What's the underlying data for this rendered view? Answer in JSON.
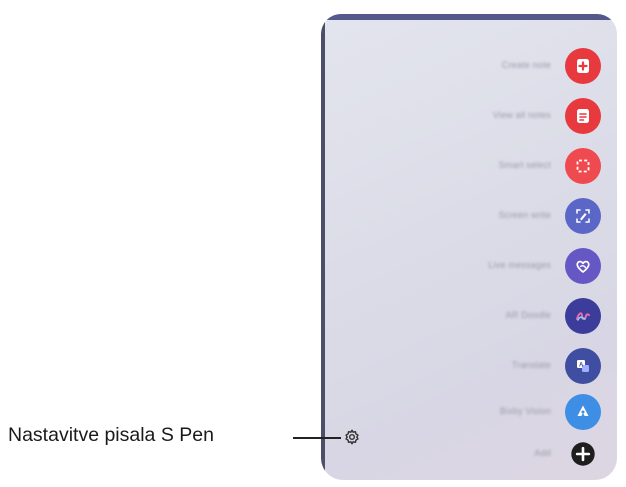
{
  "callout": {
    "label": "Nastavitve pisala S Pen"
  },
  "air_command": {
    "items": [
      {
        "label": "Create note",
        "icon": "create-note-icon",
        "color": "#e8393f"
      },
      {
        "label": "View all notes",
        "icon": "view-all-notes-icon",
        "color": "#e8393f"
      },
      {
        "label": "Smart select",
        "icon": "smart-select-icon",
        "color": "#ee4a4f"
      },
      {
        "label": "Screen write",
        "icon": "screen-write-icon",
        "color": "#5b67c7"
      },
      {
        "label": "Live messages",
        "icon": "live-messages-icon",
        "color": "#6658c4"
      },
      {
        "label": "AR Doodle",
        "icon": "ar-doodle-icon",
        "color": "#3c3c9a"
      },
      {
        "label": "Translate",
        "icon": "translate-icon",
        "color": "#3f4ea0"
      },
      {
        "label": "Bixby Vision",
        "icon": "bixby-vision-icon",
        "color": "#3f8ee6"
      },
      {
        "label": "Add",
        "icon": "add-icon",
        "color": "#1e1e1e"
      }
    ],
    "settings_icon": "settings-gear-icon"
  },
  "colors": {
    "panel_top": "#55588a",
    "panel_background": "#dcdde8"
  }
}
